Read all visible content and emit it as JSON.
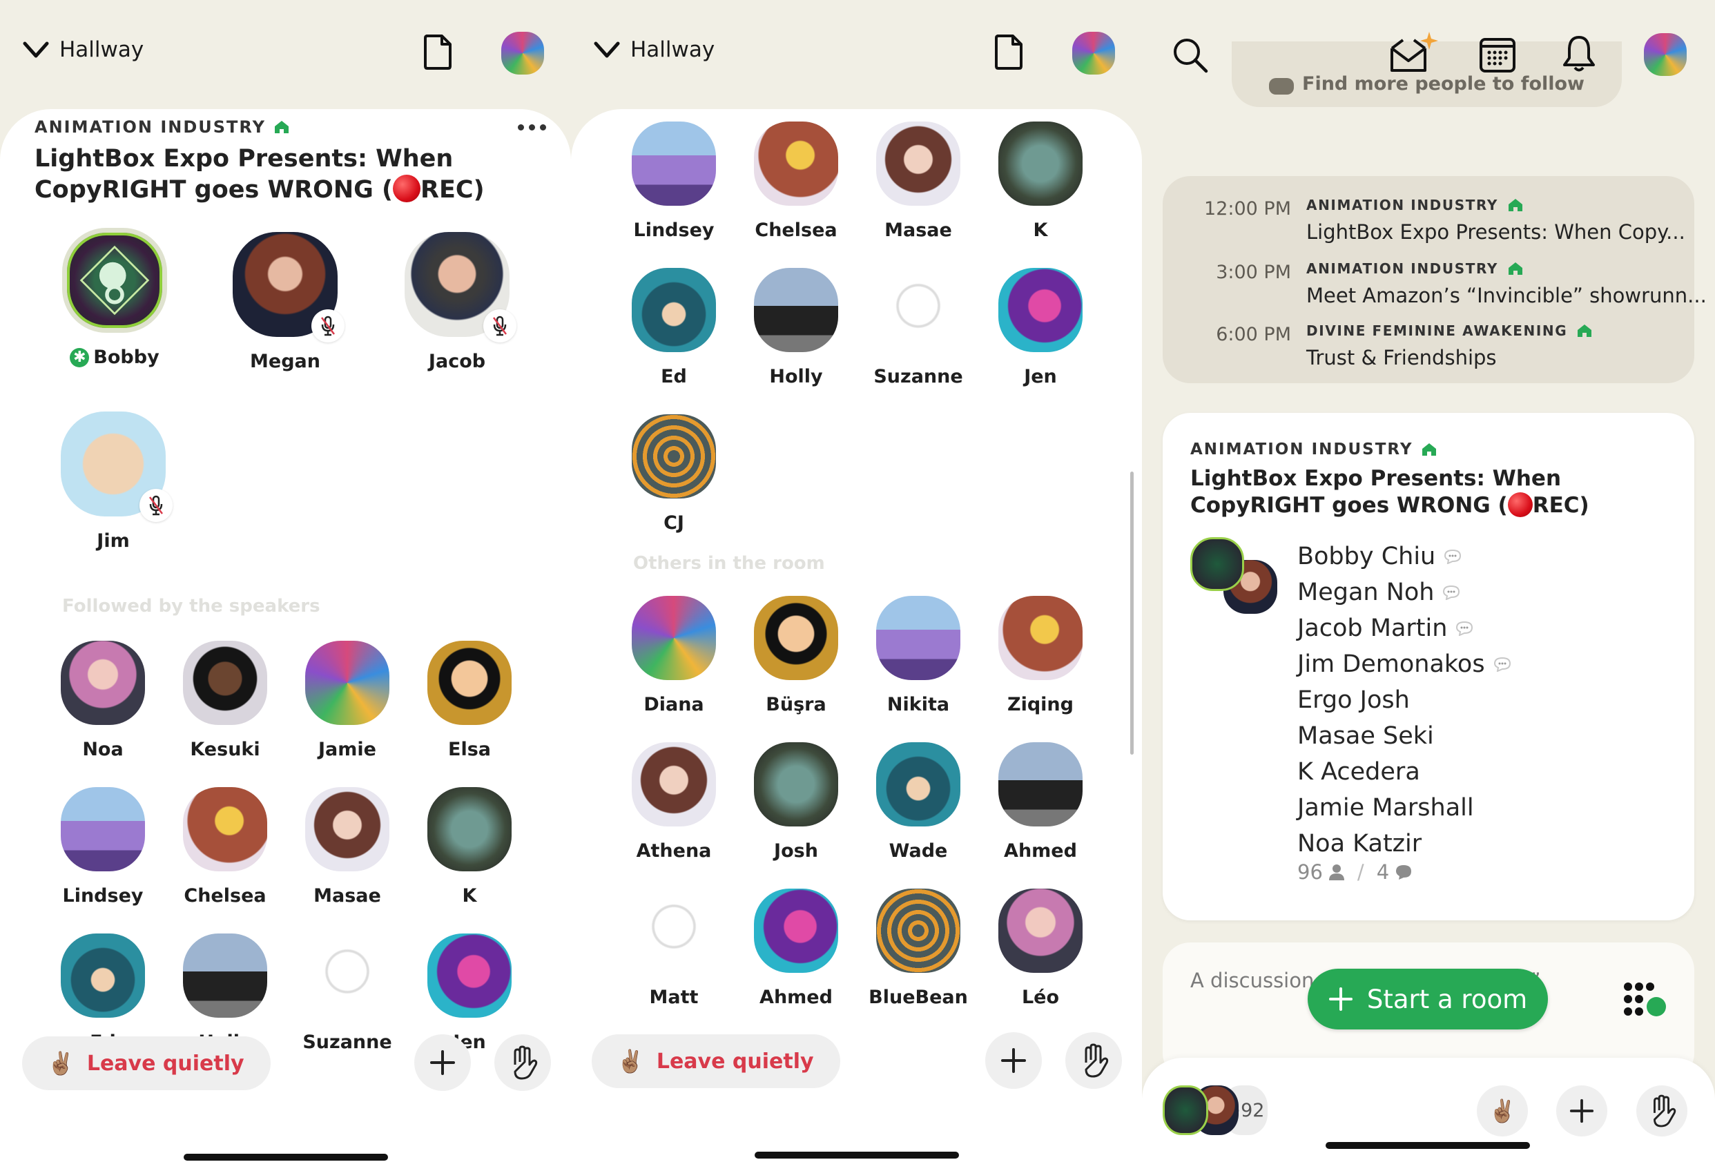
{
  "colors": {
    "background": "#f1efe5",
    "accent_green": "#27a955",
    "leave_red": "#d83a4a",
    "rec_red": "#d90f1a"
  },
  "panel1": {
    "header": {
      "back_label": "Hallway",
      "icons": [
        "chevron-down-icon",
        "document-icon",
        "profile-avatar"
      ]
    },
    "room": {
      "club": "ANIMATION INDUSTRY",
      "title": "LightBox Expo Presents: When CopyRIGHT goes WRONG (",
      "title_suffix": "REC)",
      "speakers": [
        {
          "name": "Bobby",
          "moderator": true,
          "muted": false
        },
        {
          "name": "Megan",
          "muted": true
        },
        {
          "name": "Jacob",
          "muted": true
        },
        {
          "name": "Jim",
          "muted": true
        }
      ],
      "followed_label": "Followed by the speakers",
      "followed": [
        "Noa",
        "Kesuki",
        "Jamie",
        "Elsa",
        "Lindsey",
        "Chelsea",
        "Masae",
        "K",
        "Ed",
        "Holly",
        "Suzanne",
        "Jen"
      ]
    },
    "footer": {
      "leave_label": "Leave quietly",
      "leave_emoji": "✌🏽"
    }
  },
  "panel2": {
    "header": {
      "back_label": "Hallway"
    },
    "followed": [
      "Lindsey",
      "Chelsea",
      "Masae",
      "K",
      "Ed",
      "Holly",
      "Suzanne",
      "Jen",
      "CJ"
    ],
    "others_label": "Others in the room",
    "others": [
      "Diana",
      "Büşra",
      "Nikita",
      "Ziqing",
      "Athena",
      "Josh",
      "Wade",
      "Ahmed",
      "Matt",
      "Ahmed",
      "BlueBean",
      "Léo"
    ],
    "footer": {
      "leave_label": "Leave quietly",
      "leave_emoji": "✌🏽"
    }
  },
  "panel3": {
    "header_icons": [
      "search-icon",
      "invite-envelope-icon",
      "calendar-icon",
      "bell-icon",
      "profile-avatar"
    ],
    "find_people_label": "Find more people to follow",
    "schedule": [
      {
        "time": "12:00 PM",
        "club": "ANIMATION INDUSTRY",
        "title": "LightBox Expo Presents: When Copy..."
      },
      {
        "time": "3:00 PM",
        "club": "ANIMATION INDUSTRY",
        "title": "Meet Amazon’s “Invincible” showrunn..."
      },
      {
        "time": "6:00 PM",
        "club": "DIVINE FEMININE AWAKENING",
        "title": "Trust & Friendships"
      }
    ],
    "room_card": {
      "club": "ANIMATION INDUSTRY",
      "title": "LightBox Expo Presents: When CopyRIGHT goes WRONG (",
      "title_suffix": "REC)",
      "participants": [
        {
          "name": "Bobby Chiu",
          "speaking": true
        },
        {
          "name": "Megan Noh",
          "speaking": true
        },
        {
          "name": "Jacob Martin",
          "speaking": true
        },
        {
          "name": "Jim Demonakos",
          "speaking": true
        },
        {
          "name": "Ergo Josh",
          "speaking": false
        },
        {
          "name": "Masae Seki",
          "speaking": false
        },
        {
          "name": "K Acedera",
          "speaking": false
        },
        {
          "name": "Jamie Marshall",
          "speaking": false
        },
        {
          "name": "Noa Katzir",
          "speaking": false
        }
      ],
      "listener_count": "96",
      "speaker_count": "4"
    },
    "next_card_text": "A discussion",
    "next_card_text_tail": "ls”",
    "start_room_label": "Start a room",
    "dock": {
      "more_count": "+92",
      "wave_emoji": "✌🏽"
    }
  }
}
